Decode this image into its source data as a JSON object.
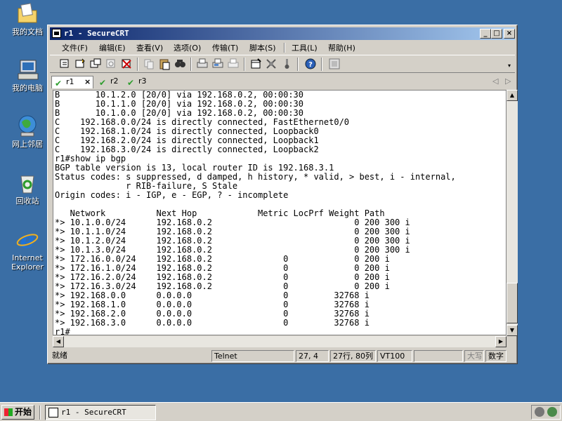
{
  "desktop": {
    "icons": [
      {
        "label": "我的文档",
        "icon": "my-documents-icon"
      },
      {
        "label": "我的电脑",
        "icon": "my-computer-icon"
      },
      {
        "label": "网上邻居",
        "icon": "network-places-icon"
      },
      {
        "label": "回收站",
        "icon": "recycle-bin-icon"
      },
      {
        "label_line1": "Internet",
        "label_line2": "Explorer",
        "icon": "internet-explorer-icon"
      }
    ]
  },
  "window": {
    "title": "r1 - SecureCRT",
    "title_gradient": [
      "#0a246a",
      "#a6caf0"
    ]
  },
  "menu": [
    "文件(F)",
    "编辑(E)",
    "查看(V)",
    "选项(O)",
    "传输(T)",
    "脚本(S)",
    "工具(L)",
    "帮助(H)"
  ],
  "tabs": [
    {
      "label": "r1",
      "close": "×"
    },
    {
      "label": "r2"
    },
    {
      "label": "r3"
    }
  ],
  "terminal": {
    "lines": [
      "B       10.1.2.0 [20/0] via 192.168.0.2, 00:00:30",
      "B       10.1.1.0 [20/0] via 192.168.0.2, 00:00:30",
      "B       10.1.0.0 [20/0] via 192.168.0.2, 00:00:30",
      "C    192.168.0.0/24 is directly connected, FastEthernet0/0",
      "C    192.168.1.0/24 is directly connected, Loopback0",
      "C    192.168.2.0/24 is directly connected, Loopback1",
      "C    192.168.3.0/24 is directly connected, Loopback2",
      "r1#show ip bgp",
      "BGP table version is 13, local router ID is 192.168.3.1",
      "Status codes: s suppressed, d damped, h history, * valid, > best, i - internal,",
      "              r RIB-failure, S Stale",
      "Origin codes: i - IGP, e - EGP, ? - incomplete",
      "",
      "   Network          Next Hop            Metric LocPrf Weight Path",
      "*> 10.1.0.0/24      192.168.0.2                            0 200 300 i",
      "*> 10.1.1.0/24      192.168.0.2                            0 200 300 i",
      "*> 10.1.2.0/24      192.168.0.2                            0 200 300 i",
      "*> 10.1.3.0/24      192.168.0.2                            0 200 300 i",
      "*> 172.16.0.0/24    192.168.0.2              0             0 200 i",
      "*> 172.16.1.0/24    192.168.0.2              0             0 200 i",
      "*> 172.16.2.0/24    192.168.0.2              0             0 200 i",
      "*> 172.16.3.0/24    192.168.0.2              0             0 200 i",
      "*> 192.168.0.0      0.0.0.0                  0         32768 i",
      "*> 192.168.1.0      0.0.0.0                  0         32768 i",
      "*> 192.168.2.0      0.0.0.0                  0         32768 i",
      "*> 192.168.3.0      0.0.0.0                  0         32768 i",
      "r1#"
    ]
  },
  "status": {
    "ready": "就绪",
    "protocol": "Telnet",
    "cursor": "27,  4",
    "size": "27行, 80列",
    "emulation": "VT100",
    "caps": "大写",
    "num": "数字"
  },
  "taskbar": {
    "start": "开始",
    "task": "r1 - SecureCRT"
  },
  "colors": {
    "desktop": "#3a6ea5",
    "chrome": "#d4d0c8",
    "check": "#2e9e2e"
  }
}
